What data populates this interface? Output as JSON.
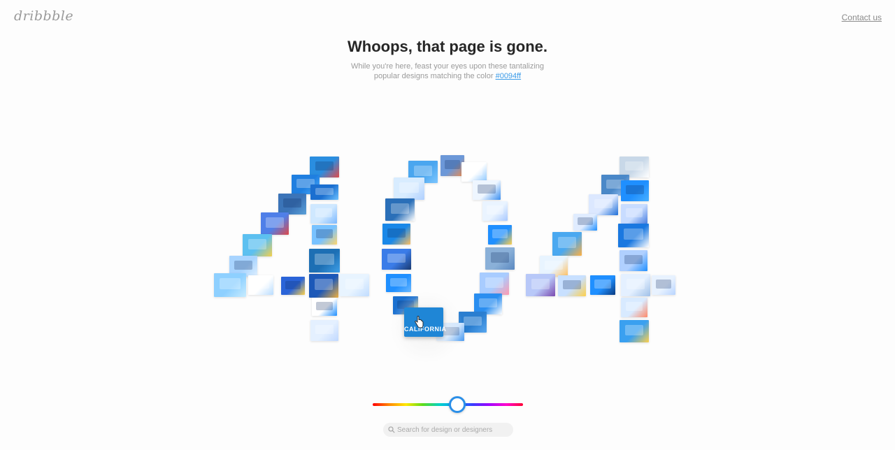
{
  "header": {
    "logo_text": "dribbble",
    "contact_label": "Contact us"
  },
  "main": {
    "title": "Whoops, that page is gone.",
    "subtitle_text": "While you're here, feast your eyes upon these tantalizing popular designs matching the color ",
    "color_link": "#0094ff",
    "focused_shot_text": "CALIFORNIA"
  },
  "color_slider": {
    "value_color": "#0094ff",
    "position_fraction": 0.56
  },
  "search": {
    "placeholder": "Search for design or designers"
  },
  "theme": {
    "accent": "#0094ff",
    "link": "#3a9be8",
    "thumb_border": "#2b8fe8"
  },
  "icons": [
    "search-icon",
    "cursor-hand-icon"
  ]
}
